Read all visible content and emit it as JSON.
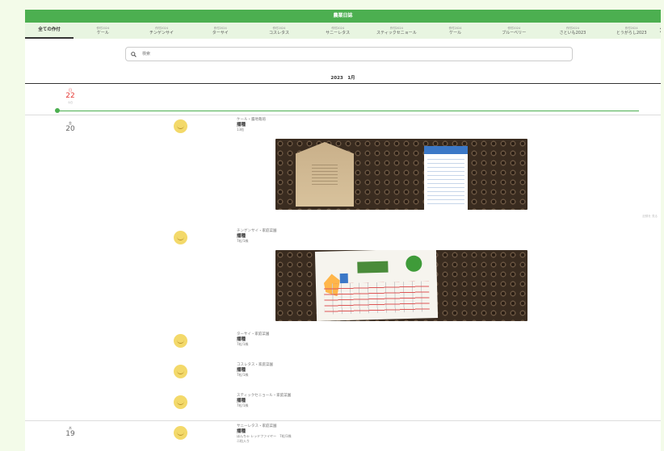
{
  "app": {
    "title": "農業日誌"
  },
  "tabs": {
    "all_label": "全ての作付",
    "items": [
      {
        "sub": "作付2024",
        "label": "ケール"
      },
      {
        "sub": "作付2024",
        "label": "チンゲンサイ"
      },
      {
        "sub": "作付2024",
        "label": "ターサイ"
      },
      {
        "sub": "作付2024",
        "label": "コスレタス"
      },
      {
        "sub": "作付2024",
        "label": "サニーレタス"
      },
      {
        "sub": "作付2024",
        "label": "スティックセニョール"
      },
      {
        "sub": "作付2024",
        "label": "ケール"
      },
      {
        "sub": "作付2024",
        "label": "ブルーベリー"
      },
      {
        "sub": "作付2024",
        "label": "さといも2023"
      },
      {
        "sub": "作付2024",
        "label": "とうがらし2023"
      }
    ],
    "more_icon": "chevron-right"
  },
  "search": {
    "placeholder": "検索"
  },
  "timeline": {
    "month_label": "2023　1月",
    "today": {
      "dow": "日",
      "num": "22",
      "sub": "今日"
    },
    "dates": [
      {
        "dow": "金",
        "num": "20"
      },
      {
        "dow": "木",
        "num": "19"
      }
    ],
    "side_note": "記録を 見る"
  },
  "entries": [
    {
      "tag": "ケール・露地栽培",
      "type": "播種",
      "detail": "13粒"
    },
    {
      "tag": "チンゲンサイ・家庭菜園",
      "type": "播種",
      "detail": "7粒/1株"
    },
    {
      "tag": "ターサイ・家庭菜園",
      "type": "播種",
      "detail": "7粒/1株"
    },
    {
      "tag": "コスレタス・家庭菜園",
      "type": "播種",
      "detail": "7粒/1株"
    },
    {
      "tag": "スティックセニョール・家庭菜園",
      "type": "播種",
      "detail": "7粒/1株"
    },
    {
      "tag": "サニーレタス・家庭菜園",
      "type": "播種",
      "detail": "ほんちゃ レッドファイヤー　7粒/1株",
      "detail2": "二粒入り"
    }
  ],
  "colors": {
    "brand": "#4caf50",
    "today": "#e53935",
    "avatar": "#f3d96a"
  }
}
